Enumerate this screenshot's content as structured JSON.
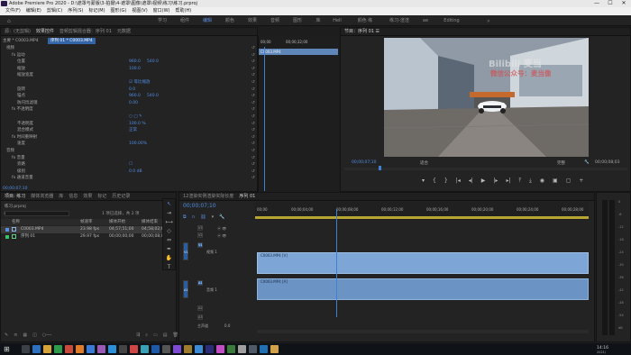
{
  "title_bar": {
    "text": "Adobe Premiere Pro 2020 - D:\\遮罩与蒙版\\3-拍摄\\4-遮罩\\图像\\遮罩\\视频\\练习\\练习.prproj",
    "min": "—",
    "max": "☐",
    "close": "✕"
  },
  "menu": [
    "文件(F)",
    "编辑(E)",
    "剪辑(C)",
    "序列(S)",
    "标记(M)",
    "图形(G)",
    "视图(V)",
    "窗口(W)",
    "帮助(H)"
  ],
  "workspaces": [
    "学习",
    "组件",
    "编辑",
    "颜色",
    "效果",
    "音频",
    "图形",
    "库",
    "Hell",
    "颜色 练",
    "练习-渲渲",
    "ae",
    "Editing"
  ],
  "active_workspace": "编辑",
  "effect_controls": {
    "tabs": [
      "源：(无剪辑)",
      "效果控件",
      "音频剪辑混合器：序列 01",
      "元数据"
    ],
    "clip_path": "主要 * C0003.MP4",
    "clip_path2": "序列 01 * C0003.MP4",
    "sections": [
      {
        "label": "视频",
        "indent": 0
      },
      {
        "label": "fx 运动",
        "indent": 1
      },
      {
        "label": "位置",
        "indent": 2,
        "v1": "960.0",
        "v2": "540.0"
      },
      {
        "label": "缩放",
        "indent": 2,
        "v1": "100.0"
      },
      {
        "label": "缩放宽度",
        "indent": 2,
        "v1": ""
      },
      {
        "label": "",
        "indent": 2,
        "v1": "☑ 等比缩放"
      },
      {
        "label": "旋转",
        "indent": 2,
        "v1": "0.0"
      },
      {
        "label": "锚点",
        "indent": 2,
        "v1": "960.0",
        "v2": "540.0"
      },
      {
        "label": "防闪烁滤镜",
        "indent": 2,
        "v1": "0.00"
      },
      {
        "label": "fx 不透明度",
        "indent": 1
      },
      {
        "label": "",
        "indent": 2,
        "v1": "○ □ ✎"
      },
      {
        "label": "不透明度",
        "indent": 2,
        "v1": "100.0 %"
      },
      {
        "label": "混合模式",
        "indent": 2,
        "v1": "正常"
      },
      {
        "label": "fx 时间重映射",
        "indent": 1
      },
      {
        "label": "速度",
        "indent": 2,
        "v1": "100.00%"
      },
      {
        "label": "音频",
        "indent": 0
      },
      {
        "label": "fx 音量",
        "indent": 1
      },
      {
        "label": "旁路",
        "indent": 2,
        "v1": "☐"
      },
      {
        "label": "级别",
        "indent": 2,
        "v1": "0.0 dB"
      },
      {
        "label": "fx 通道音量",
        "indent": 1
      }
    ],
    "timecode": "00;00;07;10",
    "mini_tc1": "00;00",
    "mini_tc2": "00;00;32;00",
    "mini_clip": "C0003.MP4"
  },
  "program_monitor": {
    "title": "节目：序列 01 ☰",
    "watermark1": "Bilibili 麦当",
    "watermark2": "微信公众号：麦当像",
    "timecode": "00;00;07;10",
    "fit": "适合",
    "quality": "完整",
    "duration": "00;00;08;03"
  },
  "project": {
    "tabs": [
      "项目: 练习",
      "媒体浏览器",
      "库",
      "信息",
      "效果",
      "标记",
      "历史记录"
    ],
    "file": "练习.prproj",
    "selection": "1 项已选择，共 2 项",
    "columns": [
      "名称",
      "帧速率",
      "媒体开始",
      "媒体结束"
    ],
    "items": [
      {
        "name": "C0003.MP4",
        "fps": "23.98 fps",
        "start": "04;57;51;00",
        "end": "04;58;02;02",
        "color": "#5b8de0"
      },
      {
        "name": "序列 01",
        "fps": "29.97 fps",
        "start": "00;00;00;00",
        "end": "00;00;08;02",
        "color": "#3bbf6a"
      }
    ]
  },
  "timeline": {
    "tabs": [
      "12渲染实例渲染实际长度",
      "序列 01"
    ],
    "timecode": "00;00;07;10",
    "ruler": [
      "00;00",
      "00;00;04;00",
      "00;00;08;00",
      "00;00;12;00",
      "00;00;16;00",
      "00;00;20;00",
      "00;00;24;00",
      "00;00;28;00"
    ],
    "video_tracks": [
      "V3",
      "V2",
      "V1"
    ],
    "audio_tracks": [
      "A1",
      "A2",
      "A3"
    ],
    "v1_label": "视频 1",
    "a1_label": "音频 1",
    "clip_v": "C0003.MP4 [V]",
    "clip_a": "C0003.MP4 [A]",
    "master": "主声道",
    "master_val": "0.0",
    "meter_labels": [
      "0",
      "-6",
      "-12",
      "-18",
      "-24",
      "-30",
      "-36",
      "-42",
      "-48",
      "-54",
      "dB"
    ]
  },
  "taskbar": {
    "time": "14:16",
    "date": "2021/"
  },
  "colors": {
    "accent": "#5b8de0",
    "clip_video": "#7da6d6",
    "clip_audio": "#6b93c4",
    "playhead": "#3e7fd8"
  }
}
